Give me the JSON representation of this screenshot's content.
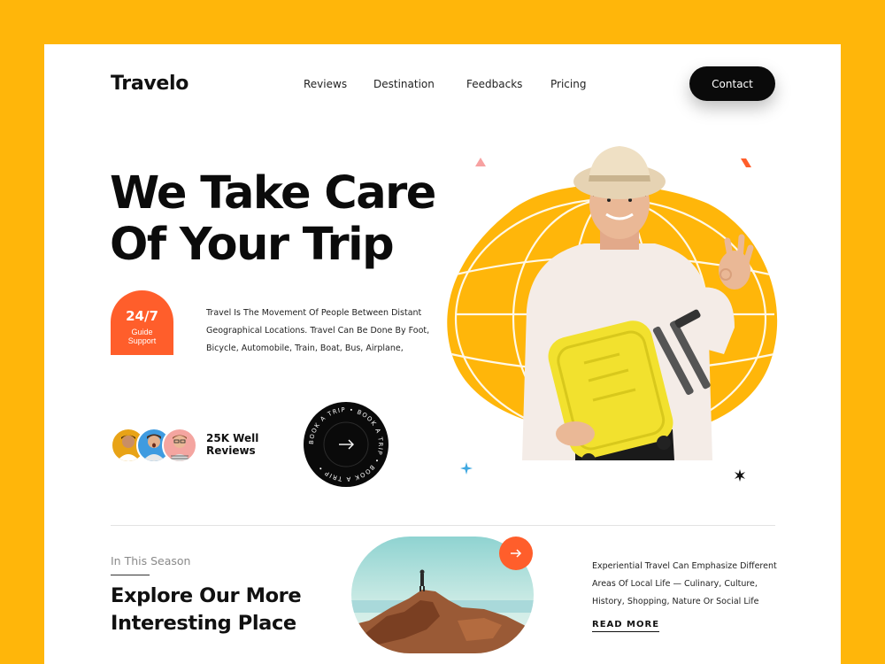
{
  "brand": {
    "name": "Travelo"
  },
  "nav": {
    "items": [
      {
        "label": "Reviews"
      },
      {
        "label": "Destination"
      },
      {
        "label": "Feedbacks"
      },
      {
        "label": "Pricing"
      }
    ],
    "contact_label": "Contact"
  },
  "hero": {
    "title_line1": "We Take Care",
    "title_line2": "Of Your Trip",
    "support_hours": "24/7",
    "support_label": "Guide Support",
    "description": "Travel Is The Movement Of People Between Distant Geographical Locations. Travel Can Be Done By Foot, Bicycle, Automobile, Train, Boat, Bus, Airplane,",
    "reviews_label": "25K Well Reviews",
    "book_ring_text": "BOOK A TRIP • BOOK A TRIP • BOOK A TRIP •",
    "colors": {
      "accent": "#FF5E2B",
      "blob": "#FFB60A",
      "page_bg": "#FFB60A"
    }
  },
  "explore": {
    "eyebrow": "In This Season",
    "title_line1": "Explore Our More",
    "title_line2": "Interesting Place",
    "description": "Experiential Travel Can Emphasize Different Areas Of Local Life — Culinary, Culture, History, Shopping, Nature Or Social Life",
    "read_more_label": "READ MORE"
  }
}
